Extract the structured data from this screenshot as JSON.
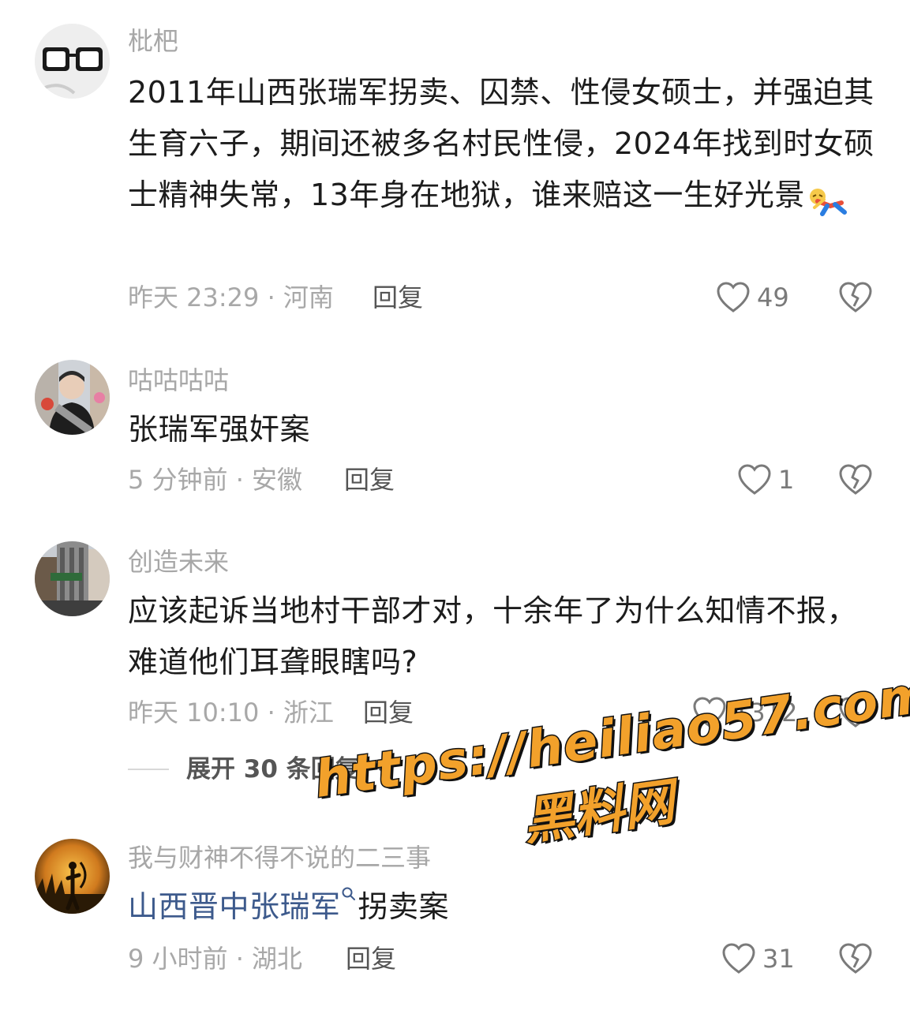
{
  "comments": [
    {
      "username": "枇杷",
      "text": "2011年山西张瑞军拐卖、囚禁、性侵女硕士，并强迫其生育六子，期间还被多名村民性侵，2024年找到时女硕士精神失常，13年身在地狱，谁来赔这一生好光景",
      "emoji": "falling-person-emoji",
      "meta": "昨天 23:29 · 河南",
      "reply_label": "回复",
      "likes": "49"
    },
    {
      "username": "咕咕咕咕",
      "text": "张瑞军强奸案",
      "meta": "5 分钟前 · 安徽",
      "reply_label": "回复",
      "likes": "1"
    },
    {
      "username": "创造未来",
      "text": "应该起诉当地村干部才对，十余年了为什么知情不报，难道他们耳聋眼瞎吗?",
      "meta": "昨天 10:10 · 浙江",
      "reply_label": "回复",
      "likes": "1312",
      "expand_label": "展开 30 条回复"
    },
    {
      "username": "我与财神不得不说的二三事",
      "link_text": "山西晋中张瑞军",
      "text_after_link": "拐卖案",
      "meta": "9 小时前 · 湖北",
      "reply_label": "回复",
      "likes": "31"
    }
  ],
  "watermark": {
    "line1": "https://heiliao57.com",
    "line2": "黑料网"
  },
  "icons": {
    "like": "heart-outline-icon",
    "dislike": "broken-heart-icon",
    "expand": "chevron-down-icon",
    "search": "search-icon"
  },
  "colors": {
    "link": "#3d5a8c",
    "watermark_fill": "#f2a12b",
    "meta": "#a8a8a8",
    "username": "#a7a7a7"
  }
}
